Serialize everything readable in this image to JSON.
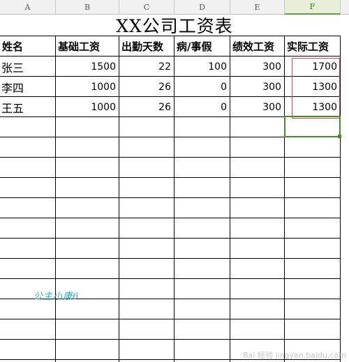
{
  "columns": [
    "A",
    "B",
    "C",
    "D",
    "E",
    "F"
  ],
  "title": "XX公司工资表",
  "headers": [
    "姓名",
    "基础工资",
    "出勤天数",
    "病/事假",
    "绩效工资",
    "实际工资"
  ],
  "rows": [
    [
      "张三",
      "1500",
      "22",
      "100",
      "300",
      "1700"
    ],
    [
      "李四",
      "1000",
      "26",
      "0",
      "300",
      "1300"
    ],
    [
      "王五",
      "1000",
      "26",
      "0",
      "300",
      "1300"
    ]
  ],
  "signature": "公主小康6",
  "watermark": "Bai 经验 jingyan.baidu.com",
  "colors": {
    "selection": "#4a8a2c",
    "highlight_box": "#c0504d",
    "signature": "#25a8cf"
  }
}
